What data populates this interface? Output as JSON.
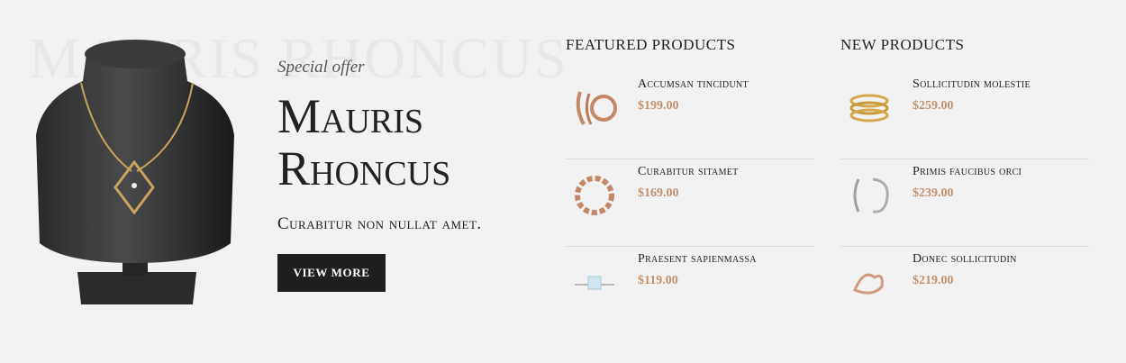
{
  "hero": {
    "background_text": "MAURIS RHONCUS",
    "eyebrow": "Special offer",
    "title_line1": "Mauris",
    "title_line2": "Rhoncus",
    "subtitle": "Curabitur non nullat amet.",
    "button_label": "VIEW MORE",
    "image_icon": "necklace-bust-icon"
  },
  "featured": {
    "heading": "FEATURED PRODUCTS",
    "items": [
      {
        "name": "Accumsan tincidunt",
        "price": "$199.00",
        "icon": "rose-gold-earrings-icon"
      },
      {
        "name": "Curabitur sitamet",
        "price": "$169.00",
        "icon": "rose-gold-chain-bracelet-icon"
      },
      {
        "name": "Praesent sapienmassa",
        "price": "$119.00",
        "icon": "diamond-ring-icon"
      }
    ]
  },
  "new_products": {
    "heading": "NEW PRODUCTS",
    "items": [
      {
        "name": "Sollicitudin molestie",
        "price": "$259.00",
        "icon": "gold-stacked-ring-icon"
      },
      {
        "name": "Primis faucibus orci",
        "price": "$239.00",
        "icon": "silver-hoop-earrings-icon"
      },
      {
        "name": "Donec sollicitudin",
        "price": "$219.00",
        "icon": "rose-gold-heart-ring-icon"
      }
    ]
  },
  "colors": {
    "background": "#f3f2f2",
    "price": "#c0916e",
    "button": "#1f1f1f"
  }
}
